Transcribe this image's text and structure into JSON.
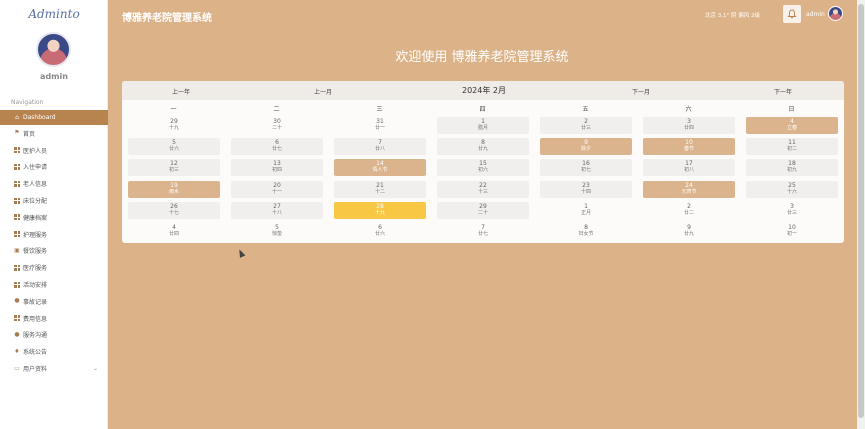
{
  "app": {
    "brand": "Adminto",
    "title": "博雅养老院管理系统",
    "welcome": "欢迎使用 博雅养老院管理系统"
  },
  "header": {
    "weather": "北京 3.1° 阴 偏风 2级",
    "username": "admin"
  },
  "sidebar": {
    "username": "admin",
    "nav_title": "Navigation",
    "items": [
      {
        "label": "Dashboard",
        "icon": "home-icon",
        "active": true
      },
      {
        "label": "首页",
        "icon": "flag-icon"
      },
      {
        "label": "医护人员",
        "icon": "grid-icon"
      },
      {
        "label": "入住申请",
        "icon": "grid-icon"
      },
      {
        "label": "老人信息",
        "icon": "grid-icon"
      },
      {
        "label": "床位分配",
        "icon": "grid-icon"
      },
      {
        "label": "健康档案",
        "icon": "grid-icon"
      },
      {
        "label": "护理服务",
        "icon": "grid-icon"
      },
      {
        "label": "餐饮服务",
        "icon": "lock-icon"
      },
      {
        "label": "医疗服务",
        "icon": "grid-icon"
      },
      {
        "label": "活动安排",
        "icon": "grid-icon"
      },
      {
        "label": "事故记录",
        "icon": "pin-icon"
      },
      {
        "label": "费用信息",
        "icon": "grid-icon"
      },
      {
        "label": "服务沟通",
        "icon": "user-icon"
      },
      {
        "label": "系统公告",
        "icon": "trophy-icon"
      },
      {
        "label": "用户资料",
        "icon": "window-icon",
        "expandable": true
      }
    ]
  },
  "calendar": {
    "prev_year": "上一年",
    "prev_month": "上一月",
    "month_label": "2024年 2月",
    "next_month": "下一月",
    "next_year": "下一年",
    "weekdays": [
      "一",
      "二",
      "三",
      "四",
      "五",
      "六",
      "日"
    ],
    "days": [
      {
        "n": "29",
        "l": "十九",
        "t": "other"
      },
      {
        "n": "30",
        "l": "二十",
        "t": "other"
      },
      {
        "n": "31",
        "l": "廿一",
        "t": "other"
      },
      {
        "n": "1",
        "l": "腊月",
        "t": "normal"
      },
      {
        "n": "2",
        "l": "廿三",
        "t": "normal"
      },
      {
        "n": "3",
        "l": "廿四",
        "t": "normal"
      },
      {
        "n": "4",
        "l": "立春",
        "t": "hl"
      },
      {
        "n": "5",
        "l": "廿六",
        "t": "normal"
      },
      {
        "n": "6",
        "l": "廿七",
        "t": "normal"
      },
      {
        "n": "7",
        "l": "廿八",
        "t": "normal"
      },
      {
        "n": "8",
        "l": "廿九",
        "t": "normal"
      },
      {
        "n": "9",
        "l": "除夕",
        "t": "hl"
      },
      {
        "n": "10",
        "l": "春节",
        "t": "hl"
      },
      {
        "n": "11",
        "l": "初二",
        "t": "normal"
      },
      {
        "n": "12",
        "l": "初三",
        "t": "normal"
      },
      {
        "n": "13",
        "l": "初四",
        "t": "normal"
      },
      {
        "n": "14",
        "l": "情人节",
        "t": "hl"
      },
      {
        "n": "15",
        "l": "初六",
        "t": "normal"
      },
      {
        "n": "16",
        "l": "初七",
        "t": "normal"
      },
      {
        "n": "17",
        "l": "初八",
        "t": "normal"
      },
      {
        "n": "18",
        "l": "初九",
        "t": "normal"
      },
      {
        "n": "19",
        "l": "雨水",
        "t": "hl"
      },
      {
        "n": "20",
        "l": "十一",
        "t": "normal"
      },
      {
        "n": "21",
        "l": "十二",
        "t": "normal"
      },
      {
        "n": "22",
        "l": "十三",
        "t": "normal"
      },
      {
        "n": "23",
        "l": "十四",
        "t": "normal"
      },
      {
        "n": "24",
        "l": "元宵节",
        "t": "hl"
      },
      {
        "n": "25",
        "l": "十六",
        "t": "normal"
      },
      {
        "n": "26",
        "l": "十七",
        "t": "normal"
      },
      {
        "n": "27",
        "l": "十八",
        "t": "normal"
      },
      {
        "n": "28",
        "l": "十九",
        "t": "today"
      },
      {
        "n": "29",
        "l": "二十",
        "t": "normal"
      },
      {
        "n": "1",
        "l": "正月",
        "t": "other"
      },
      {
        "n": "2",
        "l": "廿二",
        "t": "other"
      },
      {
        "n": "3",
        "l": "廿三",
        "t": "other"
      },
      {
        "n": "4",
        "l": "廿四",
        "t": "other"
      },
      {
        "n": "5",
        "l": "惊蛰",
        "t": "other"
      },
      {
        "n": "6",
        "l": "廿六",
        "t": "other"
      },
      {
        "n": "7",
        "l": "廿七",
        "t": "other"
      },
      {
        "n": "8",
        "l": "妇女节",
        "t": "other"
      },
      {
        "n": "9",
        "l": "廿九",
        "t": "other"
      },
      {
        "n": "10",
        "l": "初一",
        "t": "other"
      }
    ]
  },
  "colors": {
    "accent": "#b7834e",
    "background": "#dcb388",
    "highlight": "#dbb38c",
    "today": "#f8c845"
  }
}
